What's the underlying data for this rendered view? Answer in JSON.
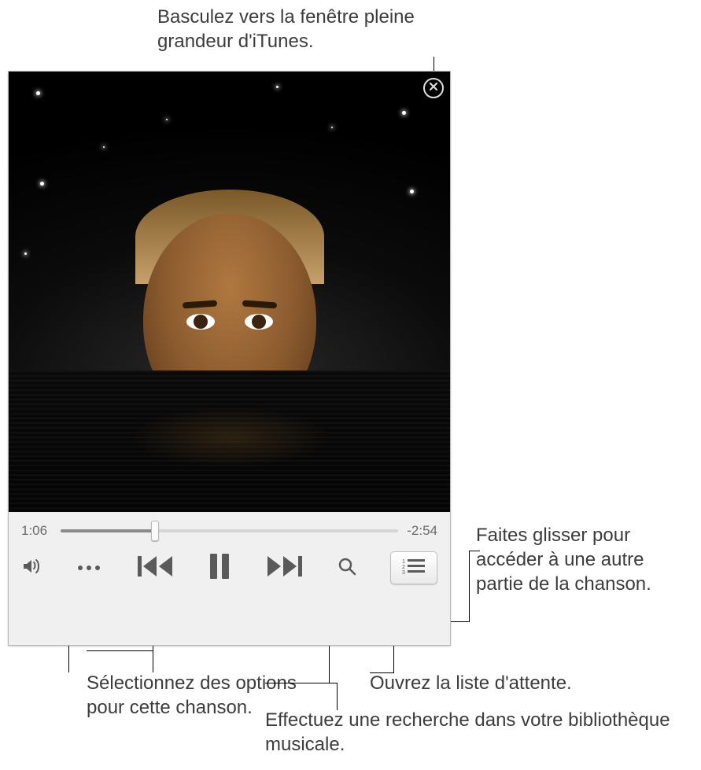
{
  "callouts": {
    "top": "Basculez vers la fenêtre pleine grandeur d'iTunes.",
    "scrub": "Faites glisser pour accéder à une autre partie de la chanson.",
    "queue": "Ouvrez la liste d'attente.",
    "search": "Effectuez une recherche dans votre bibliothèque musicale.",
    "options": "Sélectionnez des options pour cette chanson."
  },
  "player": {
    "elapsed": "1:06",
    "remaining": "-2:54",
    "progress_percent": 28
  },
  "icons": {
    "close": "close-icon",
    "volume": "volume-icon",
    "more": "ellipsis-icon",
    "prev": "previous-track-icon",
    "pause": "pause-icon",
    "next": "next-track-icon",
    "search": "search-icon",
    "queue": "queue-list-icon"
  }
}
